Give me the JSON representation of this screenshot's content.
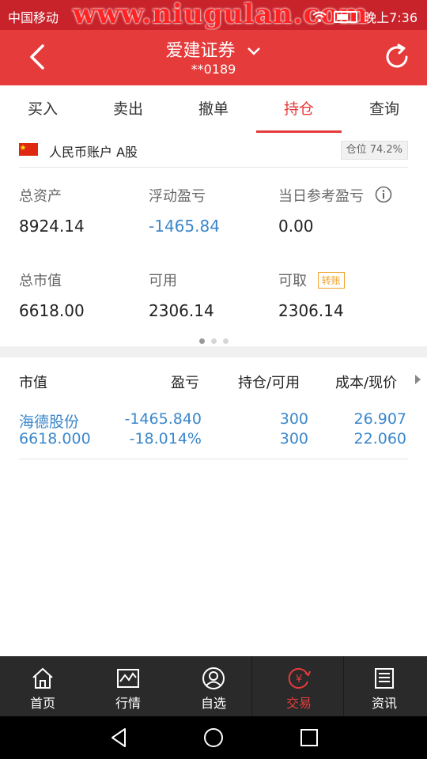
{
  "status": {
    "carrier": "中国移动",
    "watermark": "www.niugulan.com",
    "time": "晚上7:36"
  },
  "header": {
    "title": "爱建证券",
    "account_suffix": "**0189"
  },
  "tabs": [
    {
      "label": "买入",
      "active": false
    },
    {
      "label": "卖出",
      "active": false
    },
    {
      "label": "撤单",
      "active": false
    },
    {
      "label": "持仓",
      "active": true
    },
    {
      "label": "查询",
      "active": false
    }
  ],
  "account": {
    "name": "人民币账户 A股",
    "position_label": "仓位 74.2%",
    "position_ratio": 0.742
  },
  "stats": {
    "total_assets": {
      "label": "总资产",
      "value": "8924.14"
    },
    "floating_pl": {
      "label": "浮动盈亏",
      "value": "-1465.84"
    },
    "today_pl": {
      "label": "当日参考盈亏",
      "value": "0.00"
    },
    "market_value": {
      "label": "总市值",
      "value": "6618.00"
    },
    "available": {
      "label": "可用",
      "value": "2306.14"
    },
    "withdrawable": {
      "label": "可取",
      "badge": "转账",
      "value": "2306.14"
    }
  },
  "pager": {
    "pages": 3,
    "current": 1
  },
  "holdings": {
    "headers": [
      "市值",
      "盈亏",
      "持仓/可用",
      "成本/现价"
    ],
    "rows": [
      {
        "name": "海德股份",
        "market_value": "6618.000",
        "pl": "-1465.840",
        "pl_pct": "-18.014%",
        "position": "300",
        "available": "300",
        "cost": "26.907",
        "price": "22.060"
      }
    ]
  },
  "bottom_nav": [
    {
      "label": "首页",
      "icon": "home-icon"
    },
    {
      "label": "行情",
      "icon": "chart-icon"
    },
    {
      "label": "自选",
      "icon": "user-icon"
    },
    {
      "label": "交易",
      "icon": "yuan-trade-icon",
      "active": true
    },
    {
      "label": "资讯",
      "icon": "news-icon"
    }
  ],
  "colors": {
    "brand_red": "#e53b3b",
    "value_blue": "#3a87cb",
    "badge_orange": "#f0a32c"
  }
}
